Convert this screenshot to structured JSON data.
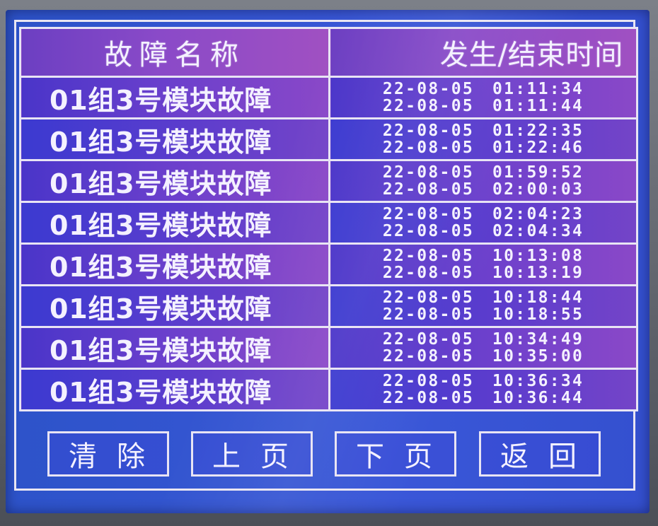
{
  "header": {
    "name_col": "故障名称",
    "time_col": "发生/结束时间"
  },
  "faults": [
    {
      "name": "01组3号模块故障",
      "start_date": "22-08-05",
      "start_time": "01:11:34",
      "end_date": "22-08-05",
      "end_time": "01:11:44"
    },
    {
      "name": "01组3号模块故障",
      "start_date": "22-08-05",
      "start_time": "01:22:35",
      "end_date": "22-08-05",
      "end_time": "01:22:46"
    },
    {
      "name": "01组3号模块故障",
      "start_date": "22-08-05",
      "start_time": "01:59:52",
      "end_date": "22-08-05",
      "end_time": "02:00:03"
    },
    {
      "name": "01组3号模块故障",
      "start_date": "22-08-05",
      "start_time": "02:04:23",
      "end_date": "22-08-05",
      "end_time": "02:04:34"
    },
    {
      "name": "01组3号模块故障",
      "start_date": "22-08-05",
      "start_time": "10:13:08",
      "end_date": "22-08-05",
      "end_time": "10:13:19"
    },
    {
      "name": "01组3号模块故障",
      "start_date": "22-08-05",
      "start_time": "10:18:44",
      "end_date": "22-08-05",
      "end_time": "10:18:55"
    },
    {
      "name": "01组3号模块故障",
      "start_date": "22-08-05",
      "start_time": "10:34:49",
      "end_date": "22-08-05",
      "end_time": "10:35:00"
    },
    {
      "name": "01组3号模块故障",
      "start_date": "22-08-05",
      "start_time": "10:36:34",
      "end_date": "22-08-05",
      "end_time": "10:36:44"
    }
  ],
  "buttons": {
    "clear": "清除",
    "prev_page": "上页",
    "next_page": "下页",
    "back": "返回"
  },
  "colors": {
    "screen_blue": "#3a57d8",
    "header_purple": "#8a4ac8",
    "line_white": "#e8e4f4"
  }
}
